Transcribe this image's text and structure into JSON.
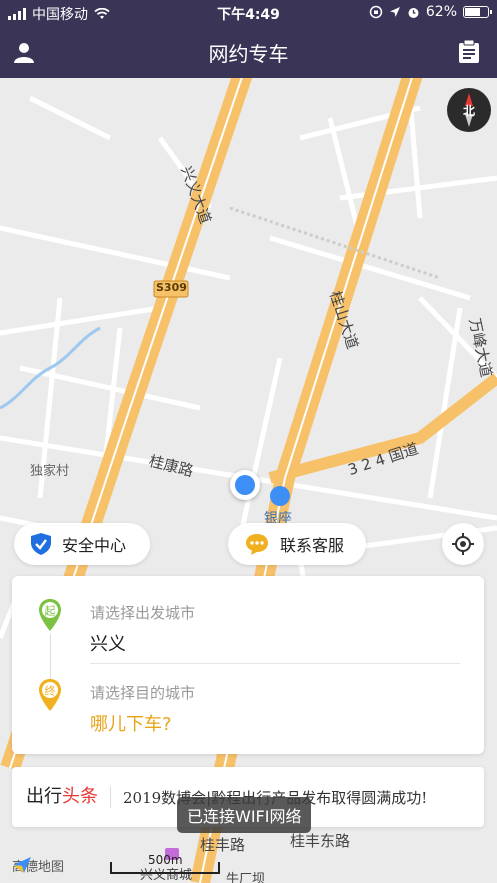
{
  "status": {
    "carrier": "中国移动",
    "time": "下午4:49",
    "battery": "62%"
  },
  "nav": {
    "title": "网约专车",
    "profile_icon": "user-icon",
    "orders_icon": "clipboard-icon"
  },
  "map": {
    "labels": {
      "xingyi_road": "兴义大道",
      "guishan_road": "桂山大道",
      "wanfeng_road": "万峰大道",
      "s309": "S309",
      "guokang_road": "桂康路",
      "guodao": "3 2 4 国道",
      "dujia_village": "独家村",
      "yinzuo": "银座",
      "guifeng_road": "桂丰路",
      "guifeng_east_road": "桂丰东路",
      "niuchangba": "牛厂坝",
      "xingyi_mall": "兴义商城"
    },
    "compass_label": "北",
    "scale_label": "500m",
    "provider": "高德地图"
  },
  "actions": {
    "safety_center": "安全中心",
    "customer_service": "联系客服"
  },
  "trip": {
    "from_badge": "起",
    "from_hint": "请选择出发城市",
    "from_value": "兴义",
    "to_badge": "终",
    "to_hint": "请选择目的城市",
    "to_value": "哪儿下车?"
  },
  "news": {
    "brand_prefix": "出行",
    "brand_suffix": "头条",
    "headline": "2019数博会|黔程出行产品发布取得圆满成功!"
  },
  "toast": "已连接WIFI网络",
  "colors": {
    "nav_bg": "#3a3556",
    "road_major": "#f7c16a",
    "from_green": "#7cc242",
    "to_yellow": "#f0b020",
    "headline_red": "#e53935",
    "locate_blue": "#3d8ff5"
  }
}
